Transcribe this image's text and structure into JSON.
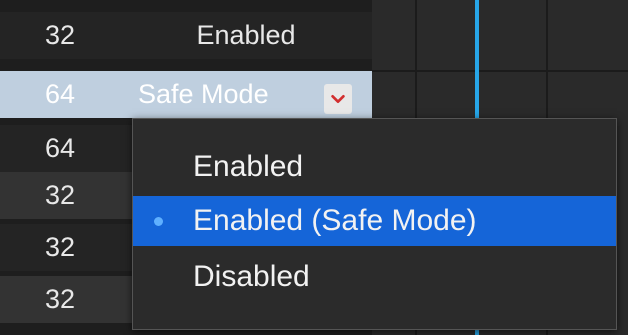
{
  "rows": [
    {
      "bits": "32",
      "mode": "Enabled"
    },
    {
      "bits": "64",
      "mode": "Safe Mode"
    },
    {
      "bits": "64",
      "mode": ""
    },
    {
      "bits": "32",
      "mode": ""
    },
    {
      "bits": "32",
      "mode": ""
    },
    {
      "bits": "32",
      "mode": ""
    }
  ],
  "dropdown": {
    "icon": "chevron-down-icon",
    "options": [
      {
        "label": "Enabled"
      },
      {
        "label": "Enabled (Safe Mode)",
        "selected": true
      },
      {
        "label": "Disabled"
      }
    ]
  },
  "colors": {
    "selected_row": "#bfcfdf",
    "menu_highlight": "#1565d8",
    "accent_line": "#27a6e8"
  }
}
